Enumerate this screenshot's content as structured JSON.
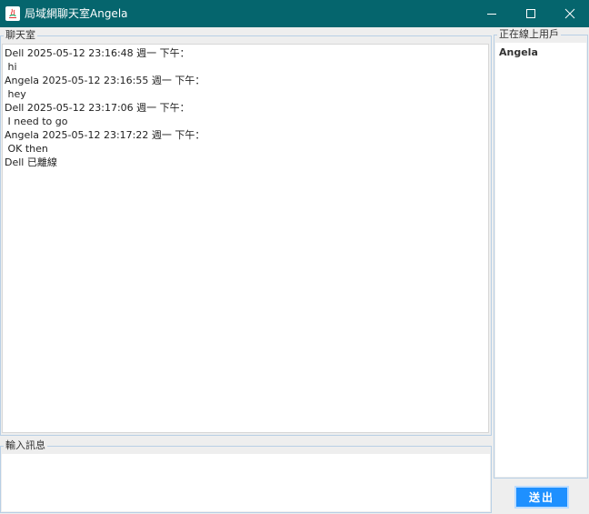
{
  "window": {
    "title": "局域網聊天室Angela",
    "icon": "java-icon",
    "controls": [
      "minimize-icon",
      "maximize-icon",
      "close-icon"
    ]
  },
  "chat": {
    "group_title": "聊天室",
    "lines": [
      "Dell 2025-05-12 23:16:48 週一 下午：",
      " hi",
      "Angela 2025-05-12 23:16:55 週一 下午：",
      " hey",
      "Dell 2025-05-12 23:17:06 週一 下午：",
      " I need to go",
      "Angela 2025-05-12 23:17:22 週一 下午：",
      " OK then",
      "Dell 已離線"
    ]
  },
  "input": {
    "group_title": "輸入訊息",
    "value": ""
  },
  "users": {
    "group_title": "正在線上用戶",
    "items": [
      "Angela"
    ]
  },
  "send_button": {
    "label": "送出"
  },
  "colors": {
    "titlebar": "#05656d",
    "border": "#b8cfe5",
    "button": "#1e90ff"
  }
}
